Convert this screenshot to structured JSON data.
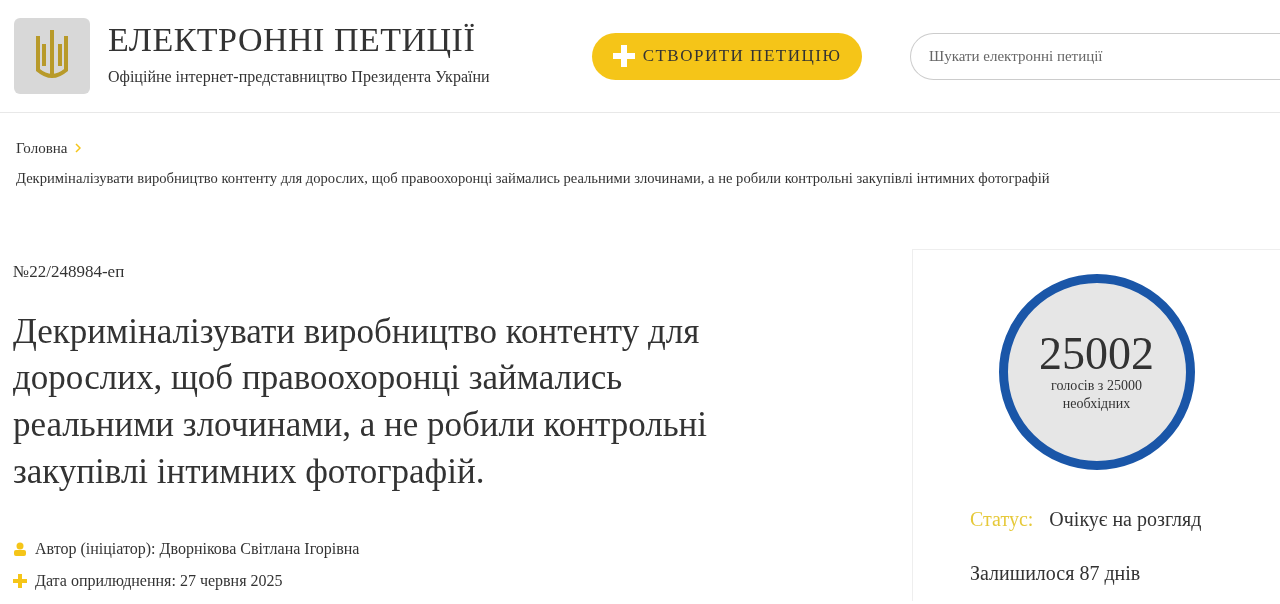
{
  "header": {
    "title": "ЕЛЕКТРОННІ ПЕТИЦІЇ",
    "subtitle": "Офіційне інтернет-представництво Президента України",
    "create_button": "СТВОРИТИ ПЕТИЦІЮ",
    "search": {
      "placeholder": "Шукати електронні петиції"
    }
  },
  "breadcrumb": [
    {
      "label": "Головна",
      "kind": "link"
    },
    {
      "label": "Декриміналізувати виробництво контенту для дорослих, щоб правоохоронці займались реальними злочинами, а не робили контрольні закупівлі інтимних фотографій",
      "kind": "current"
    }
  ],
  "petition": {
    "number": "№22/248984-еп",
    "title": "Декриміналізувати виробництво контенту для дорослих, щоб правоохоронці займались реальними злочинами, а не робили контрольні закупівлі інтимних фотографій.",
    "meta": [
      {
        "kind": "author",
        "text": "Автор (ініціатор): Дворнікова Світлана Ігорівна"
      },
      {
        "kind": "date",
        "text": "Дата оприлюднення: 27 червня 2025"
      }
    ]
  },
  "votes": {
    "count": "25002",
    "caption": "голосів з 25000 необхідних"
  },
  "status": {
    "label": "Статус:",
    "value": "Очікує на розгляд"
  },
  "remaining": "Залишилося 87 днів"
}
